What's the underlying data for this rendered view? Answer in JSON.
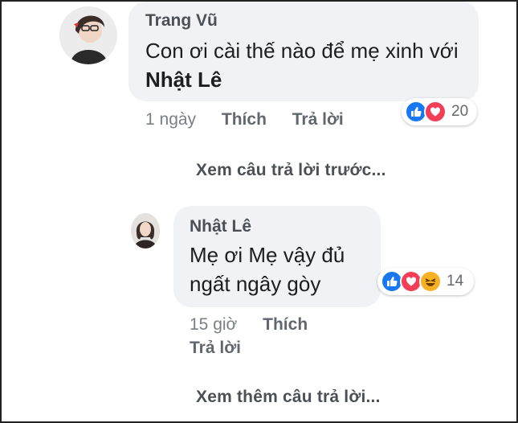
{
  "comments": [
    {
      "author": "Trang Vũ",
      "text_plain": "Con ơi cài thế nào để mẹ xinh với ",
      "mention": "Nhật Lê",
      "time": "1 ngày",
      "like_label": "Thích",
      "reply_label": "Trả lời",
      "reaction_count": "20",
      "reaction_icons": [
        "like-icon",
        "love-icon"
      ]
    },
    {
      "author": "Nhật Lê",
      "text_line1": "Mẹ ơi Mẹ vậy đủ",
      "text_line2": "ngất ngây gòy",
      "time": "15 giờ",
      "like_label": "Thích",
      "reply_label": "Trả lời",
      "reaction_count": "14",
      "reaction_icons": [
        "like-icon",
        "love-icon",
        "haha-icon"
      ]
    }
  ],
  "links": {
    "previous_replies": "Xem câu trả lời trước...",
    "more_replies": "Xem thêm câu trả lời..."
  },
  "colors": {
    "bubble": "#f0f2f5",
    "like": "#1877f2",
    "love": "#f33e58",
    "haha": "#f7b125"
  }
}
